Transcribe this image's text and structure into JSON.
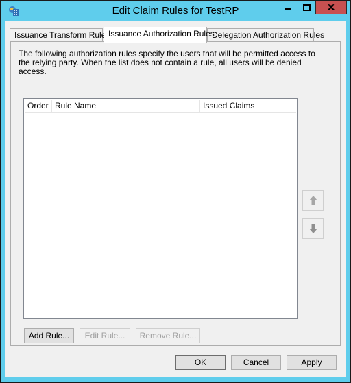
{
  "window": {
    "title": "Edit Claim Rules for TestRP",
    "app_icon": "adfs-app-icon",
    "controls": {
      "minimize": "minimize-icon",
      "maximize": "maximize-icon",
      "close": "close-icon"
    }
  },
  "tabs": [
    {
      "label": "Issuance Transform Rules",
      "active": false
    },
    {
      "label": "Issuance Authorization Rules",
      "active": true
    },
    {
      "label": "Delegation Authorization Rules",
      "active": false
    }
  ],
  "panel": {
    "description": "The following authorization rules specify the users that will be permitted access to the relying party. When the list does not contain a rule, all users will be denied access.",
    "list": {
      "columns": [
        "Order",
        "Rule Name",
        "Issued Claims"
      ],
      "rows": []
    },
    "move_up_icon": "arrow-up-icon",
    "move_down_icon": "arrow-down-icon",
    "buttons": {
      "add_rule": "Add Rule...",
      "edit_rule": "Edit Rule...",
      "remove_rule": "Remove Rule..."
    }
  },
  "footer": {
    "ok": "OK",
    "cancel": "Cancel",
    "apply": "Apply"
  }
}
